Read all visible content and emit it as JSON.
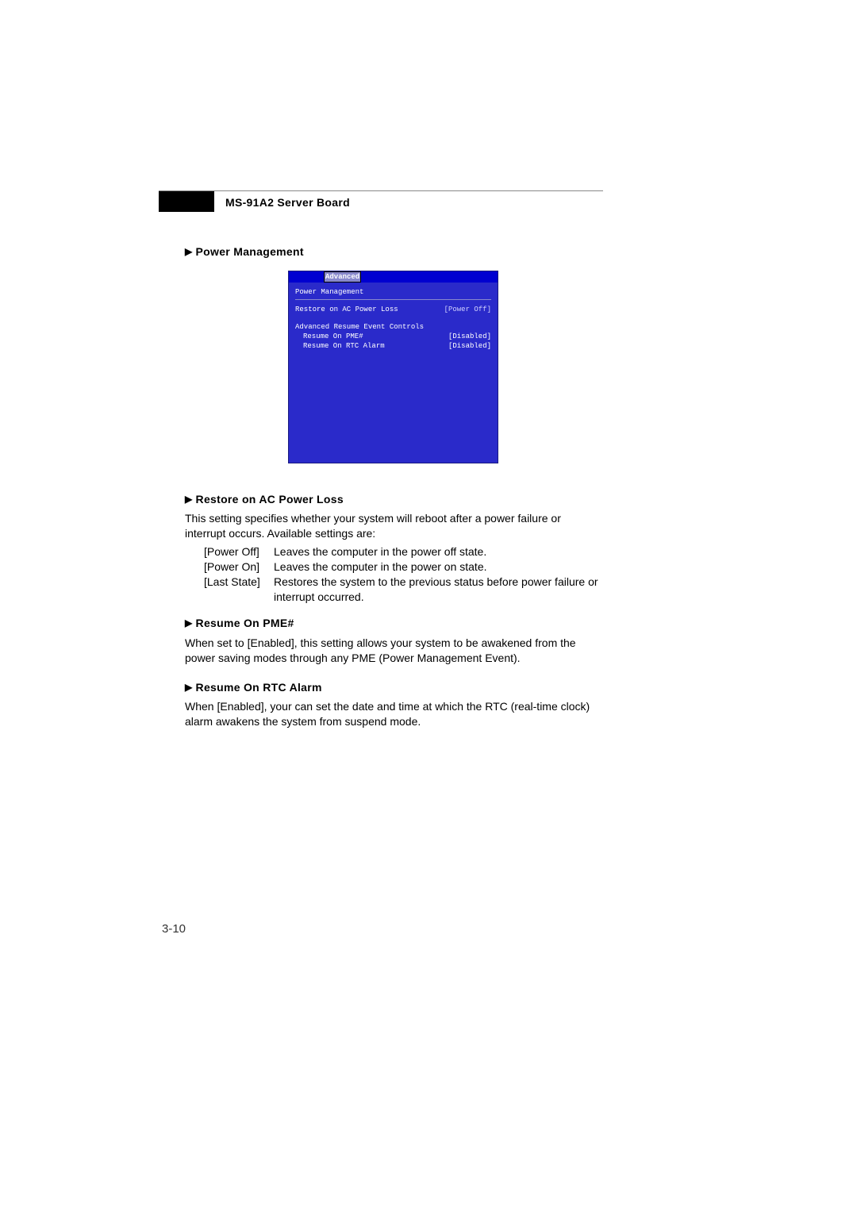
{
  "header": {
    "board_title": "MS-91A2 Server Board"
  },
  "sections": {
    "power_mgmt_title": "Power Management",
    "restore_title": "Restore on AC Power Loss",
    "restore_desc": "This setting specifies whether your system will reboot after a power failure or interrupt occurs. Available settings are:",
    "opts": {
      "poweroff_k": "[Power Off]",
      "poweroff_d": "Leaves the computer in the power off state.",
      "poweron_k": "[Power On]",
      "poweron_d": "Leaves the computer in the power on state.",
      "laststate_k": "[Last State]",
      "laststate_d": "Restores the system to the previous status before power failure or interrupt occurred."
    },
    "pme_title": "Resume On PME#",
    "pme_desc": "When set to [Enabled], this setting allows your system to be awakened from the power saving modes through any PME (Power Management Event).",
    "rtc_title": "Resume On RTC Alarm",
    "rtc_desc": "When [Enabled], your can set the date and time at which the RTC (real-time clock) alarm awakens the system from suspend mode."
  },
  "bios": {
    "tab": "Advanced",
    "screen_title": "Power Management",
    "row1_label": "Restore on AC Power Loss",
    "row1_value": "[Power Off]",
    "group_label": "Advanced Resume Event Controls",
    "sub1_label": "Resume On PME#",
    "sub1_value": "[Disabled]",
    "sub2_label": "Resume On RTC Alarm",
    "sub2_value": "[Disabled]"
  },
  "page_number": "3-10"
}
